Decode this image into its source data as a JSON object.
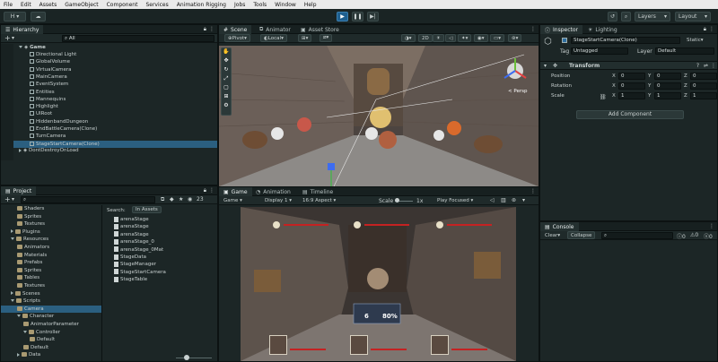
{
  "menu": [
    "File",
    "Edit",
    "Assets",
    "GameObject",
    "Component",
    "Services",
    "Animation Rigging",
    "Jobs",
    "Tools",
    "Window",
    "Help"
  ],
  "toolbar": {
    "account": "H",
    "cloud": "☁",
    "layers": "Layers",
    "layout": "Layout",
    "play": "▶",
    "pause": "❚❚",
    "step": "▶|"
  },
  "hierarchy": {
    "tab": "Hierarchy",
    "search": "All",
    "add": "+",
    "scene": "Game",
    "items": [
      "Directional Light",
      "GlobalVolume",
      "VirtualCamera",
      "MainCamera",
      "EventSystem",
      "Entities",
      "Mannequins",
      "Highlight",
      "UIRoot",
      "HiddenbandDungeon",
      "EndBattleCamera(Clone)",
      "TurnCamera",
      "StageStartCamera(Clone)"
    ],
    "dont_destroy": "DontDestroyOnLoad"
  },
  "scene": {
    "tabs": [
      "Scene",
      "Animator",
      "Asset Store"
    ],
    "pivot": "Pivot",
    "local": "Local",
    "mode_2d": "2D",
    "persp": "< Persp"
  },
  "game": {
    "tabs": [
      "Game",
      "Animation",
      "Timeline"
    ],
    "display_select": "Game",
    "display": "Display 1",
    "aspect": "16:9 Aspect",
    "scale_label": "Scale",
    "scale_value": "1x",
    "play_focused": "Play Focused",
    "hud": {
      "a": "6",
      "b": "80%"
    }
  },
  "project": {
    "tab": "Project",
    "add": "+",
    "badge": "23",
    "search_label": "Search:",
    "search_scope": "In Assets",
    "tree": [
      {
        "label": "Shaders",
        "depth": 2,
        "type": "folder"
      },
      {
        "label": "Sprites",
        "depth": 2,
        "type": "folder"
      },
      {
        "label": "Textures",
        "depth": 2,
        "type": "folder"
      },
      {
        "label": "Plugins",
        "depth": 1,
        "type": "folder",
        "arrow": "right"
      },
      {
        "label": "Resources",
        "depth": 1,
        "type": "folder",
        "arrow": "down"
      },
      {
        "label": "Animators",
        "depth": 2,
        "type": "folder"
      },
      {
        "label": "Materials",
        "depth": 2,
        "type": "folder"
      },
      {
        "label": "Prefabs",
        "depth": 2,
        "type": "folder"
      },
      {
        "label": "Sprites",
        "depth": 2,
        "type": "folder"
      },
      {
        "label": "Tables",
        "depth": 2,
        "type": "folder"
      },
      {
        "label": "Textures",
        "depth": 2,
        "type": "folder"
      },
      {
        "label": "Scenes",
        "depth": 1,
        "type": "folder",
        "arrow": "right"
      },
      {
        "label": "Scripts",
        "depth": 1,
        "type": "folder",
        "arrow": "down"
      },
      {
        "label": "Camera",
        "depth": 2,
        "type": "folder",
        "selected": true
      },
      {
        "label": "Character",
        "depth": 2,
        "type": "folder",
        "arrow": "down"
      },
      {
        "label": "AnimatorParameter",
        "depth": 3,
        "type": "folder"
      },
      {
        "label": "Controller",
        "depth": 3,
        "type": "folder",
        "arrow": "down"
      },
      {
        "label": "Default",
        "depth": 4,
        "type": "folder"
      },
      {
        "label": "Default",
        "depth": 3,
        "type": "folder"
      },
      {
        "label": "Data",
        "depth": 2,
        "type": "folder",
        "arrow": "right"
      }
    ],
    "results": [
      "arenaStage",
      "arenaStage",
      "arenaStage",
      "arenaStage_0",
      "arenaStage_0Mat",
      "StageData",
      "StageManager",
      "StageStartCamera",
      "StageTable"
    ]
  },
  "inspector": {
    "tabs": [
      "Inspector",
      "Lighting"
    ],
    "object_name": "StageStartCamera(Clone)",
    "static": "Static",
    "tag_label": "Tag",
    "tag_value": "Untagged",
    "layer_label": "Layer",
    "layer_value": "Default",
    "component": "Transform",
    "rows": [
      {
        "label": "Position",
        "x": "0",
        "y": "0",
        "z": "0"
      },
      {
        "label": "Rotation",
        "x": "0",
        "y": "0",
        "z": "0"
      },
      {
        "label": "Scale",
        "x": "1",
        "y": "1",
        "z": "1"
      }
    ],
    "axis": {
      "x": "X",
      "y": "Y",
      "z": "Z"
    },
    "add_component": "Add Component"
  },
  "console": {
    "tab": "Console",
    "clear": "Clear",
    "collapse": "Collapse",
    "counts": [
      "0",
      "0",
      "0"
    ]
  },
  "colors": {
    "accent": "#2b5f80",
    "play": "#1e5f8f",
    "panel": "#1c2626"
  }
}
